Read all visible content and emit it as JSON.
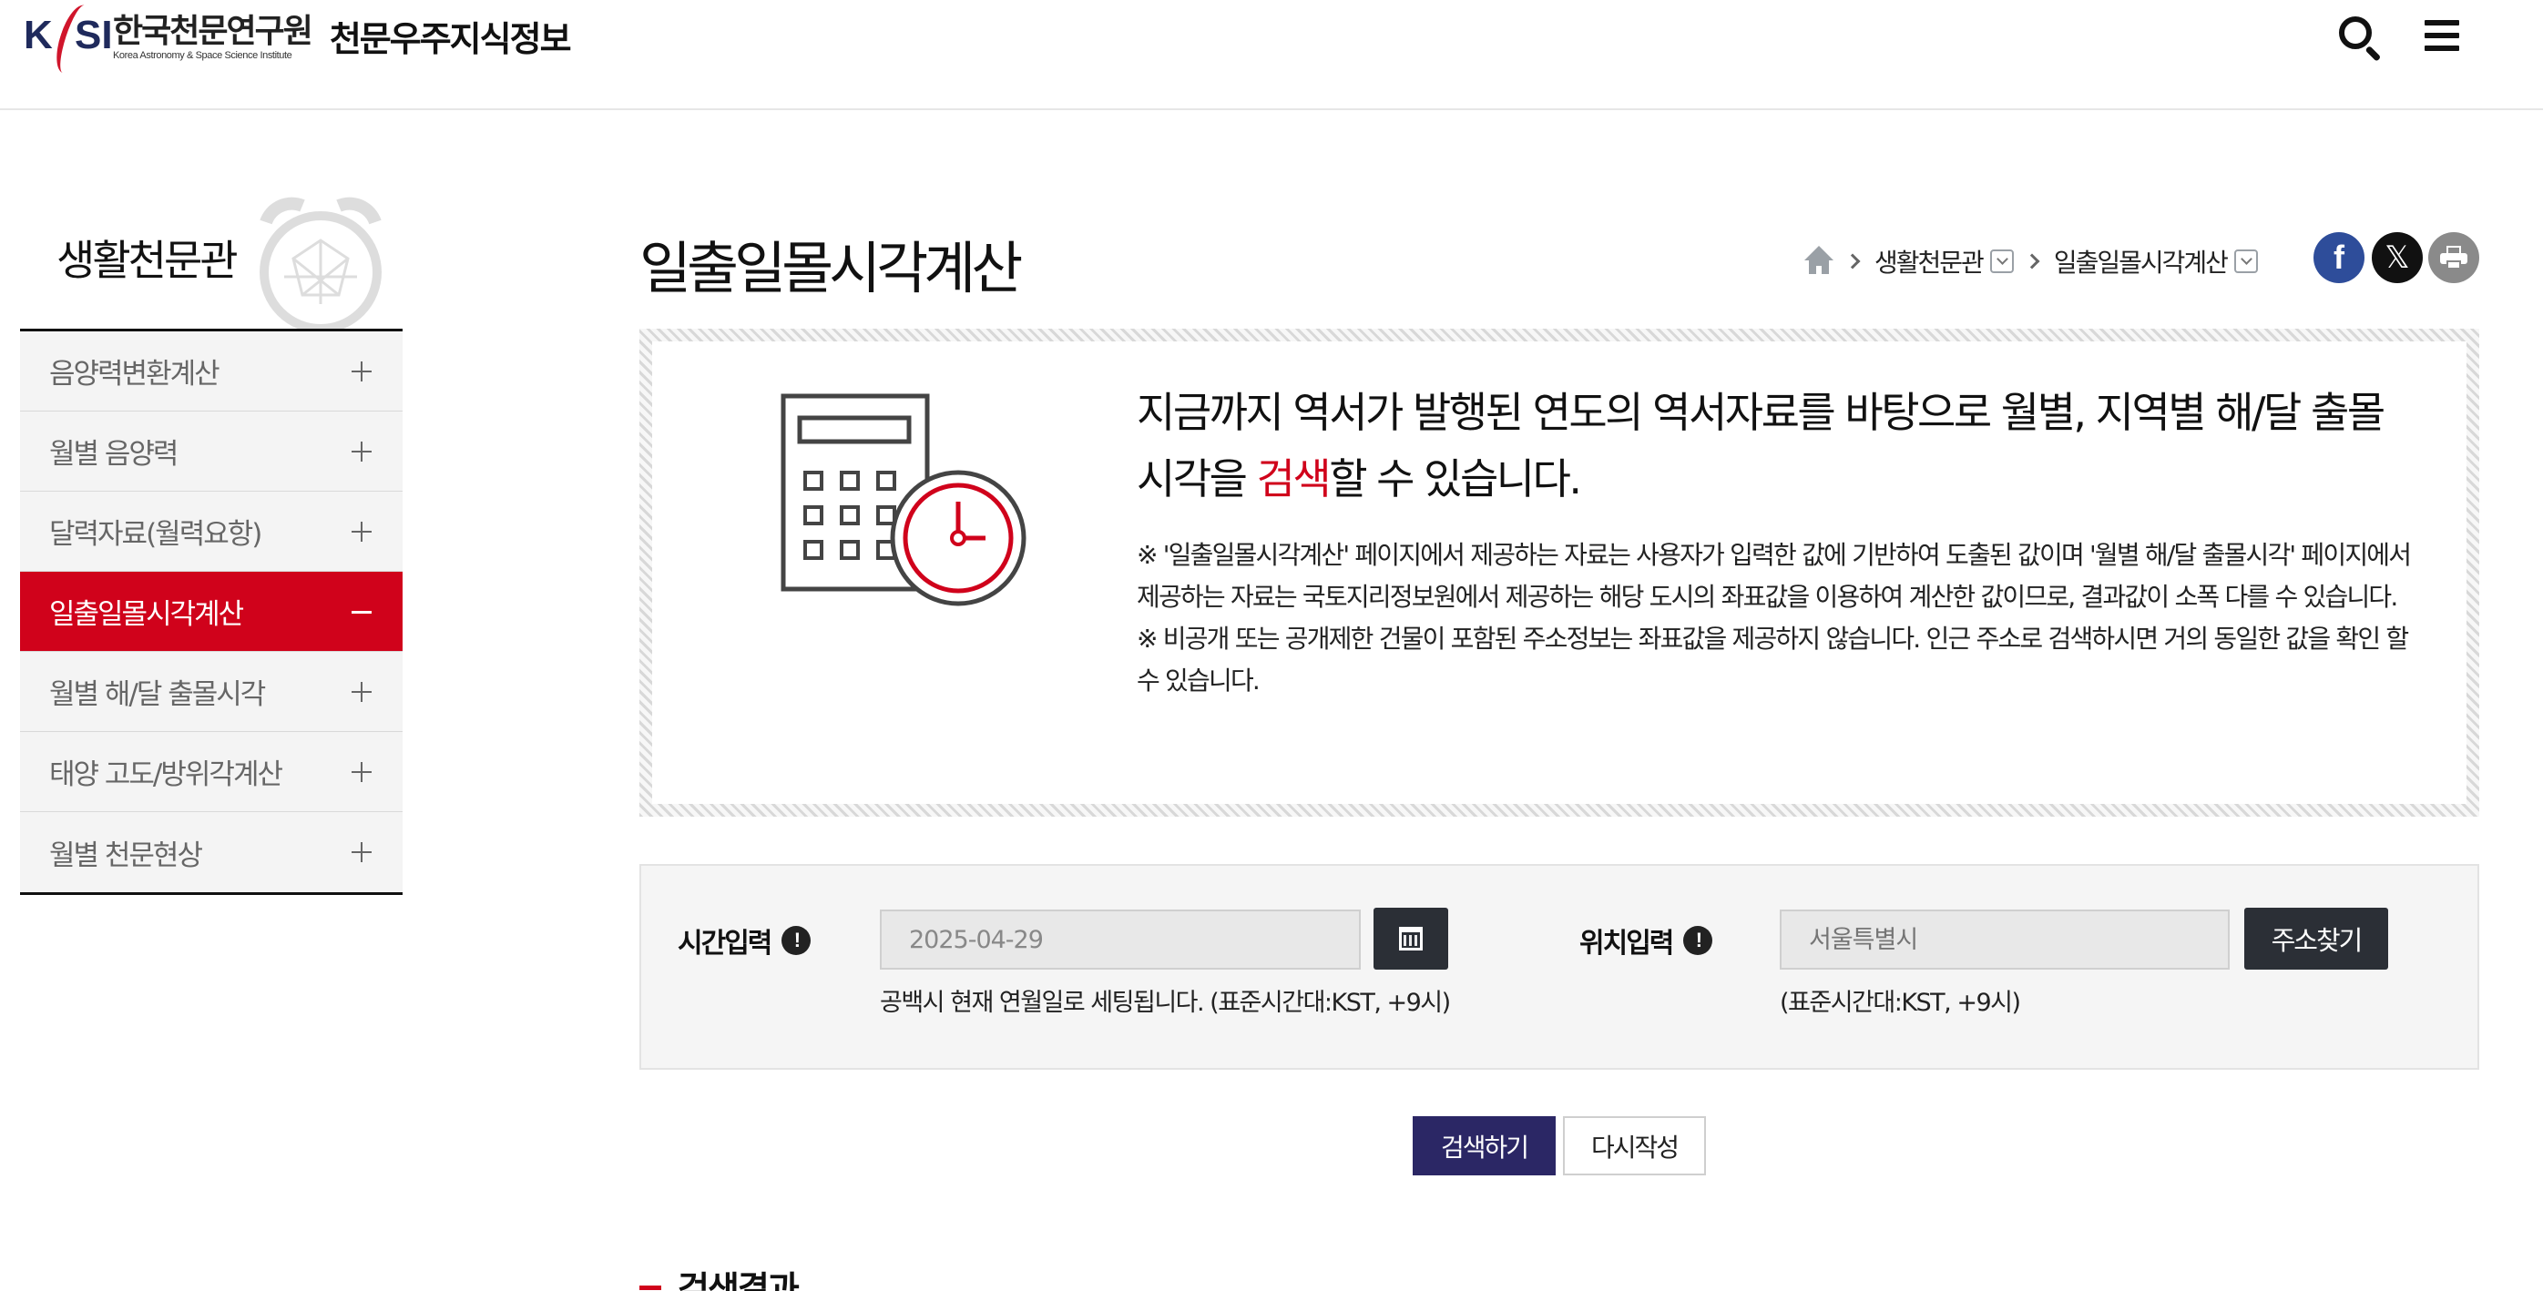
{
  "header": {
    "logo_mark": "KASI",
    "org_name": "한국천문연구원",
    "org_name_en": "Korea Astronomy & Space Science Institute",
    "site_title": "천문우주지식정보",
    "search_icon": "search-icon",
    "menu_icon": "hamburger-menu-icon"
  },
  "sidebar": {
    "title": "생활천문관",
    "items": [
      {
        "label": "음양력변환계산",
        "active": false
      },
      {
        "label": "월별 음양력",
        "active": false
      },
      {
        "label": "달력자료(월력요항)",
        "active": false
      },
      {
        "label": "일출일몰시각계산",
        "active": true
      },
      {
        "label": "월별 해/달 출몰시각",
        "active": false
      },
      {
        "label": "태양 고도/방위각계산",
        "active": false
      },
      {
        "label": "월별 천문현상",
        "active": false
      }
    ]
  },
  "main": {
    "page_title": "일출일몰시각계산",
    "breadcrumb": {
      "home_icon": "home-icon",
      "level1": "생활천문관",
      "level2": "일출일몰시각계산"
    },
    "share": {
      "facebook_glyph": "f",
      "x_glyph": "𝕏",
      "print_icon": "printer-icon"
    },
    "intro": {
      "headline_pre": "지금까지 역서가 발행된 연도의 역서자료를 바탕으로 월별, 지역별 해/달 출몰시각을 ",
      "headline_highlight": "검색",
      "headline_post": "할 수 있습니다.",
      "note1": "※ '일출일몰시각계산' 페이지에서 제공하는 자료는 사용자가 입력한 값에 기반하여 도출된 값이며 '월별 해/달 출몰시각' 페이지에서 제공하는 자료는 국토지리정보원에서 제공하는 해당 도시의 좌표값을 이용하여 계산한 값이므로, 결과값이 소폭 다를 수 있습니다.",
      "note2": "※ 비공개 또는 공개제한 건물이 포함된 주소정보는 좌표값을 제공하지 않습니다. 인근 주소로 검색하시면 거의 동일한 값을 확인 할 수 있습니다."
    },
    "form": {
      "time_label": "시간입력",
      "time_value": "2025-04-29",
      "calendar_icon": "calendar-icon",
      "time_hint": "공백시 현재 연월일로 세팅됩니다. (표준시간대:KST, +9시)",
      "location_label": "위치입력",
      "location_placeholder": "서울특별시",
      "address_button": "주소찾기",
      "location_hint": "(표준시간대:KST, +9시)",
      "info_glyph": "!"
    },
    "actions": {
      "search": "검색하기",
      "reset": "다시작성"
    },
    "result_heading": "검색결과"
  },
  "colors": {
    "accent_red": "#d0021b",
    "search_button": "#2b2765",
    "dark_button": "#2b2f36",
    "facebook": "#2e4d9a"
  }
}
